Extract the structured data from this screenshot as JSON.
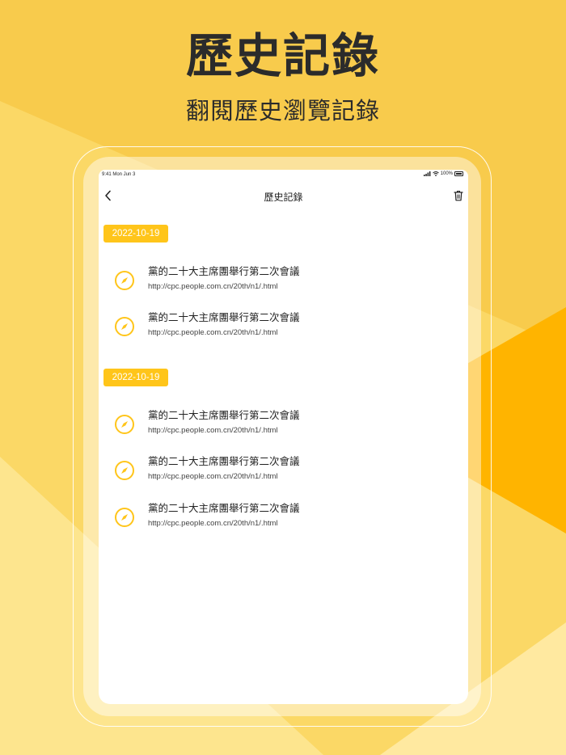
{
  "promo": {
    "headline": "歷史記錄",
    "subline": "翻閱歷史瀏覽記錄"
  },
  "colors": {
    "background": "#F8CB4C",
    "accent": "#FFC51A",
    "text": "#2B2B2B"
  },
  "status_bar": {
    "time": "9:41  Mon Jun 3",
    "battery": "100%"
  },
  "nav": {
    "title": "歷史記錄",
    "back_icon": "chevron-left-icon",
    "trash_icon": "trash-icon"
  },
  "groups": [
    {
      "date": "2022-10-19",
      "items": [
        {
          "title": "黨的二十大主席團舉行第二次會議",
          "url": "http://cpc.people.com.cn/20th/n1/.html",
          "icon": "compass-icon"
        },
        {
          "title": "黨的二十大主席團舉行第二次會議",
          "url": "http://cpc.people.com.cn/20th/n1/.html",
          "icon": "compass-icon"
        }
      ]
    },
    {
      "date": "2022-10-19",
      "items": [
        {
          "title": "黨的二十大主席團舉行第二次會議",
          "url": "http://cpc.people.com.cn/20th/n1/.html",
          "icon": "compass-icon"
        },
        {
          "title": "黨的二十大主席團舉行第二次會議",
          "url": "http://cpc.people.com.cn/20th/n1/.html",
          "icon": "compass-icon"
        },
        {
          "title": "黨的二十大主席團舉行第二次會議",
          "url": "http://cpc.people.com.cn/20th/n1/.html",
          "icon": "compass-icon"
        }
      ]
    }
  ]
}
